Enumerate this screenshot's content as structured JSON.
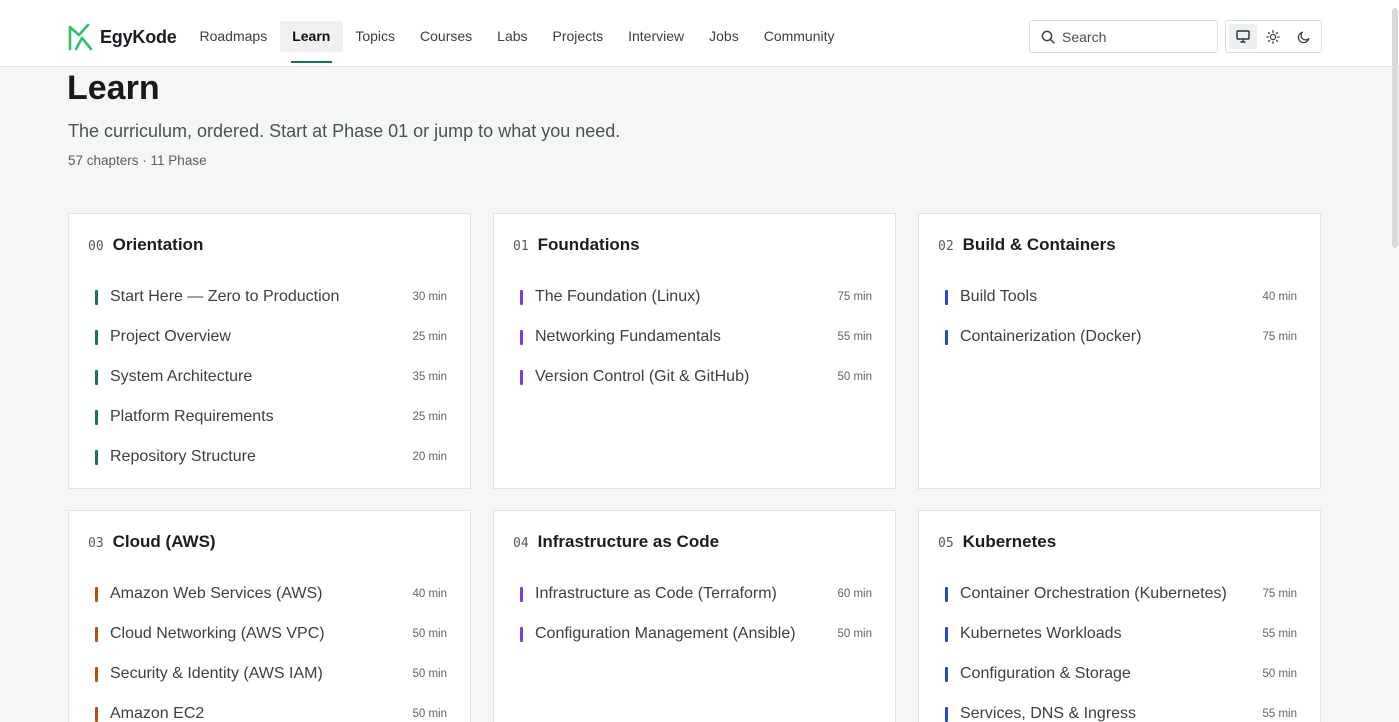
{
  "brand": {
    "name": "EgyKode"
  },
  "nav": [
    {
      "label": "Roadmaps",
      "active": false
    },
    {
      "label": "Learn",
      "active": true
    },
    {
      "label": "Topics",
      "active": false
    },
    {
      "label": "Courses",
      "active": false
    },
    {
      "label": "Labs",
      "active": false
    },
    {
      "label": "Projects",
      "active": false
    },
    {
      "label": "Interview",
      "active": false
    },
    {
      "label": "Jobs",
      "active": false
    },
    {
      "label": "Community",
      "active": false
    }
  ],
  "search": {
    "placeholder": "Search",
    "icon": "search-icon"
  },
  "theme": {
    "options": [
      "monitor-icon",
      "sun-icon",
      "moon-icon"
    ],
    "selected": "monitor-icon"
  },
  "page": {
    "title": "Learn",
    "subtitle": "The curriculum, ordered. Start at Phase 01 or jump to what you need.",
    "meta": "57 chapters · 11 Phase"
  },
  "colors": {
    "brand": "#2fbf71",
    "active_underline": "#1b6f63",
    "phase_00": "#1b6f63",
    "phase_01": "#7c3aed",
    "phase_02": "#2748c9",
    "phase_03": "#b45309",
    "phase_04": "#7c3aed",
    "phase_05": "#2748c9"
  },
  "phases": [
    {
      "num": "00",
      "title": "Orientation",
      "color": "#1b6f63",
      "chapters": [
        {
          "name": "Start Here — Zero to Production",
          "duration": "30 min"
        },
        {
          "name": "Project Overview",
          "duration": "25 min"
        },
        {
          "name": "System Architecture",
          "duration": "35 min"
        },
        {
          "name": "Platform Requirements",
          "duration": "25 min"
        },
        {
          "name": "Repository Structure",
          "duration": "20 min"
        }
      ]
    },
    {
      "num": "01",
      "title": "Foundations",
      "color": "#7c3aed",
      "chapters": [
        {
          "name": "The Foundation (Linux)",
          "duration": "75 min"
        },
        {
          "name": "Networking Fundamentals",
          "duration": "55 min"
        },
        {
          "name": "Version Control (Git & GitHub)",
          "duration": "50 min"
        }
      ]
    },
    {
      "num": "02",
      "title": "Build & Containers",
      "color": "#2748c9",
      "chapters": [
        {
          "name": "Build Tools",
          "duration": "40 min"
        },
        {
          "name": "Containerization (Docker)",
          "duration": "75 min"
        }
      ]
    },
    {
      "num": "03",
      "title": "Cloud (AWS)",
      "color": "#b45309",
      "chapters": [
        {
          "name": "Amazon Web Services (AWS)",
          "duration": "40 min"
        },
        {
          "name": "Cloud Networking (AWS VPC)",
          "duration": "50 min"
        },
        {
          "name": "Security & Identity (AWS IAM)",
          "duration": "50 min"
        },
        {
          "name": "Amazon EC2",
          "duration": "50 min"
        }
      ]
    },
    {
      "num": "04",
      "title": "Infrastructure as Code",
      "color": "#7c3aed",
      "chapters": [
        {
          "name": "Infrastructure as Code (Terraform)",
          "duration": "60 min"
        },
        {
          "name": "Configuration Management (Ansible)",
          "duration": "50 min"
        }
      ]
    },
    {
      "num": "05",
      "title": "Kubernetes",
      "color": "#2748c9",
      "chapters": [
        {
          "name": "Container Orchestration (Kubernetes)",
          "duration": "75 min"
        },
        {
          "name": "Kubernetes Workloads",
          "duration": "55 min"
        },
        {
          "name": "Configuration & Storage",
          "duration": "50 min"
        },
        {
          "name": "Services, DNS & Ingress",
          "duration": "55 min"
        }
      ]
    }
  ]
}
